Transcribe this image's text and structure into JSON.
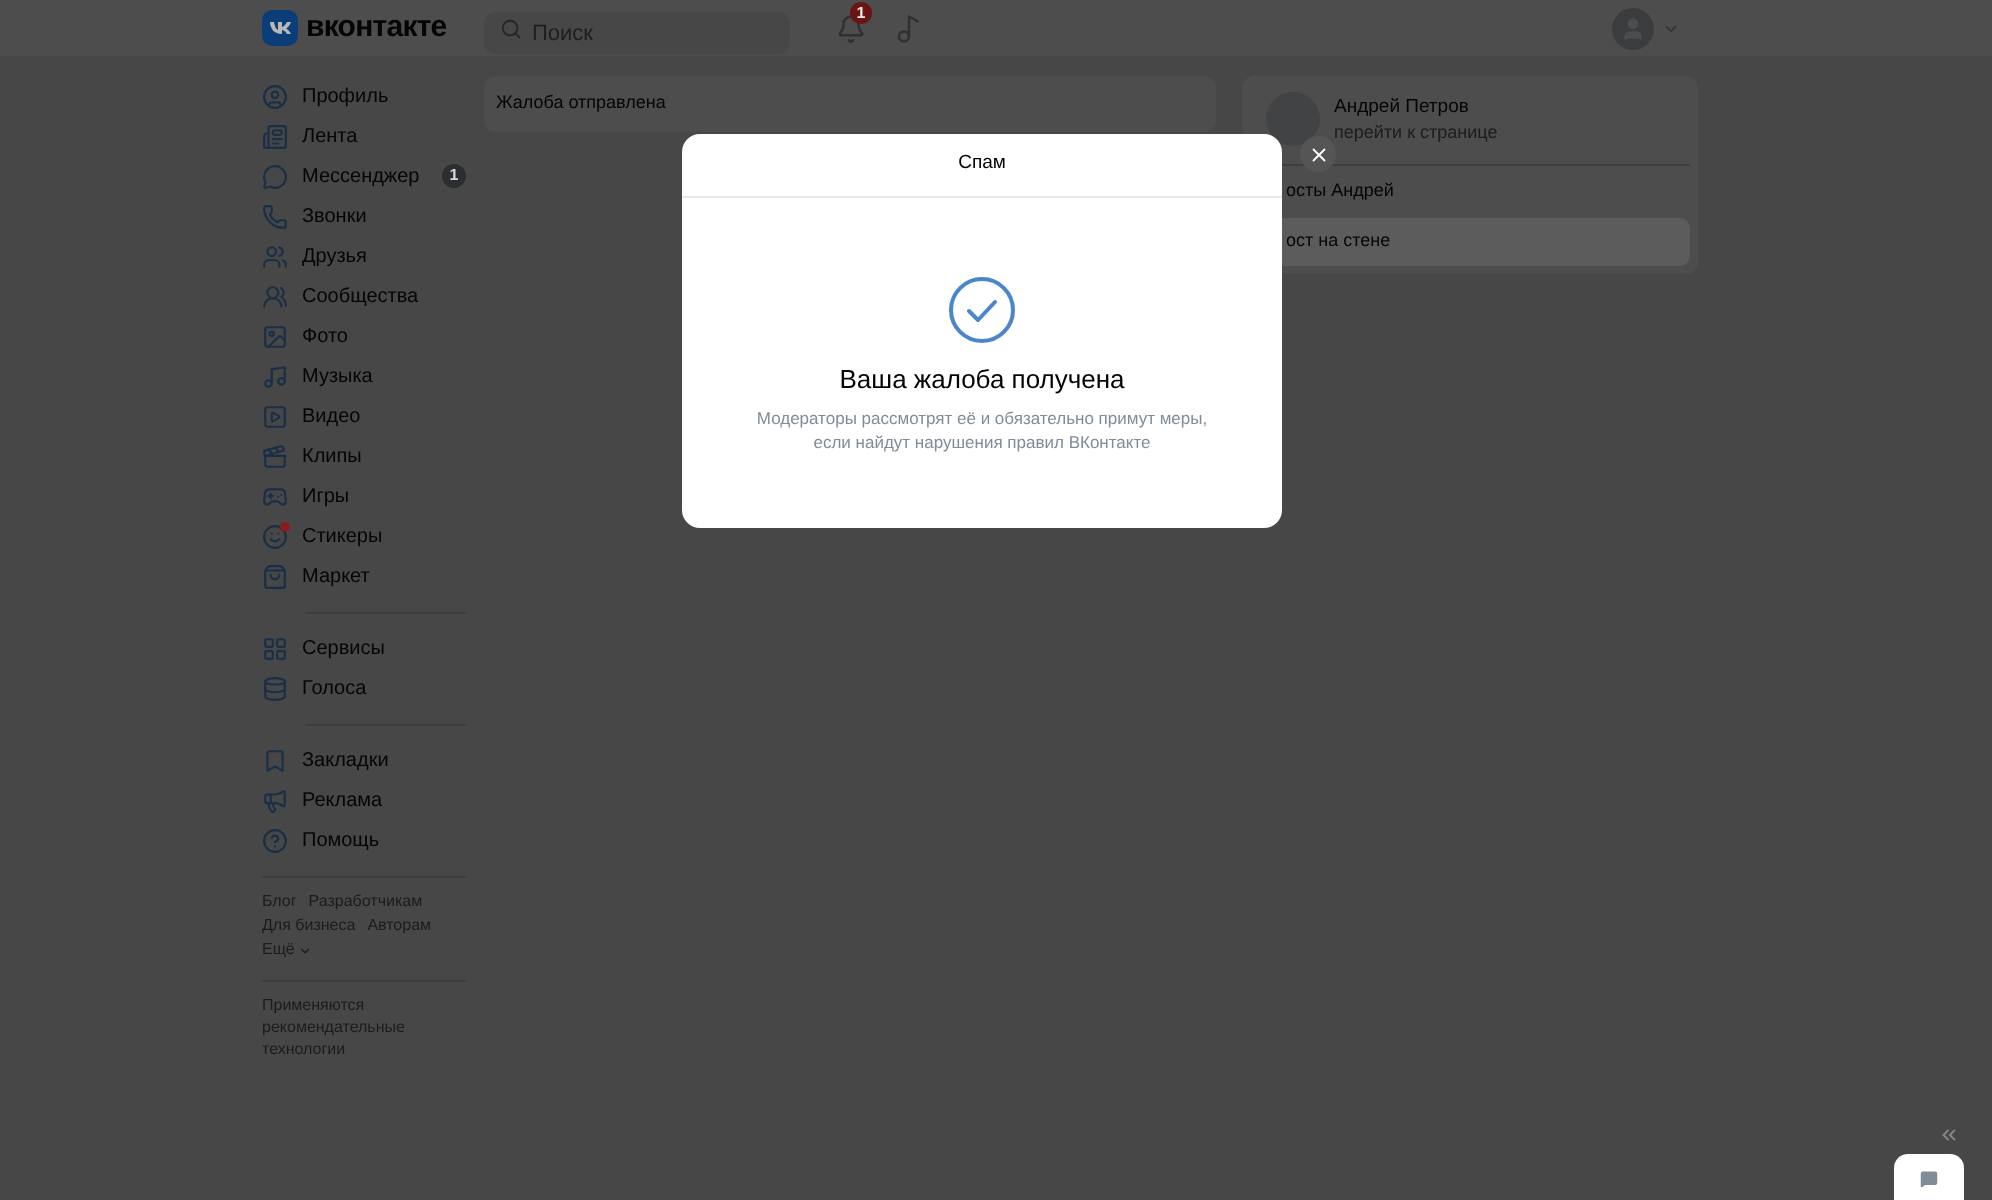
{
  "header": {
    "logo_text": "вконтакте",
    "search": {
      "placeholder": "Поиск"
    },
    "notifications_badge": "1"
  },
  "sidebar": {
    "groups": [
      [
        {
          "label": "Профиль",
          "dot": false
        },
        {
          "label": "Лента",
          "dot": false
        },
        {
          "label": "Мессенджер",
          "badge": "1",
          "dot": false
        },
        {
          "label": "Звонки",
          "dot": false
        },
        {
          "label": "Друзья",
          "dot": false
        },
        {
          "label": "Сообщества",
          "dot": false
        },
        {
          "label": "Фото",
          "dot": false
        },
        {
          "label": "Музыка",
          "dot": false
        },
        {
          "label": "Видео",
          "dot": false
        },
        {
          "label": "Клипы",
          "dot": false
        },
        {
          "label": "Игры",
          "dot": false
        },
        {
          "label": "Стикеры",
          "dot": true
        },
        {
          "label": "Маркет",
          "dot": false
        }
      ],
      [
        {
          "label": "Сервисы",
          "dot": false
        },
        {
          "label": "Голоса",
          "dot": false
        }
      ],
      [
        {
          "label": "Закладки",
          "dot": false
        },
        {
          "label": "Реклама",
          "dot": false
        },
        {
          "label": "Помощь",
          "dot": false
        }
      ]
    ],
    "footer_links": [
      "Блог",
      "Разработчикам",
      "Для бизнеса",
      "Авторам"
    ],
    "more": "Ещё",
    "note": "Применяются рекомендательные технологии"
  },
  "main": {
    "notice": "Жалоба отправлена"
  },
  "profile_card": {
    "name": "Андрей Петров",
    "link": "перейти к странице",
    "rows": [
      {
        "label": "осты Андрей",
        "selected": false
      },
      {
        "label": "ост на стене",
        "selected": true
      }
    ]
  },
  "modal": {
    "title": "Спам",
    "heading": "Ваша жалоба получена",
    "message": "Модераторы рассмотрят её и обязательно примут меры, если найдут нарушения правил ВКонтакте"
  }
}
